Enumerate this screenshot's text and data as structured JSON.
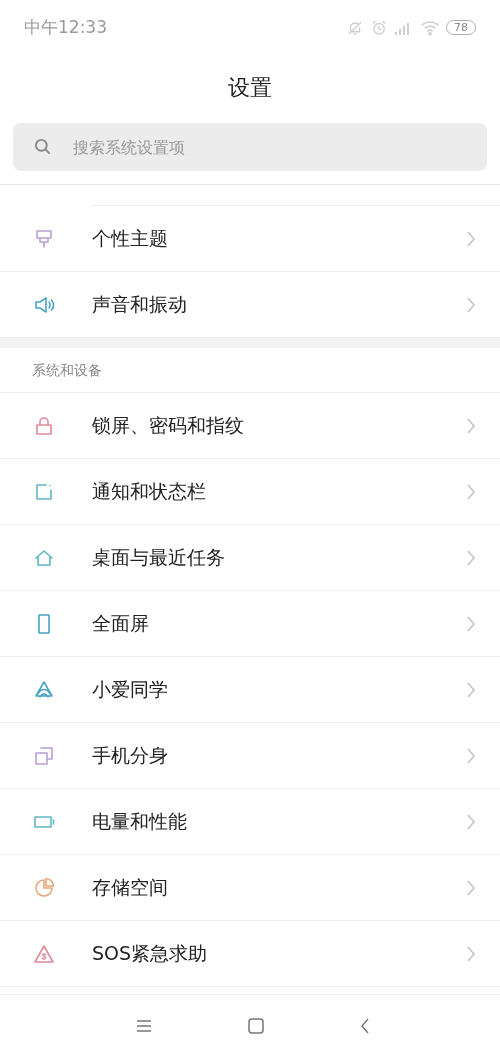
{
  "status_bar": {
    "time": "中午12:33",
    "battery": "78"
  },
  "title": "设置",
  "search": {
    "placeholder": "搜索系统设置项"
  },
  "top_items": [
    {
      "label": "个性主题"
    },
    {
      "label": "声音和振动"
    }
  ],
  "section": {
    "title": "系统和设备",
    "items": [
      {
        "label": "锁屏、密码和指纹"
      },
      {
        "label": "通知和状态栏"
      },
      {
        "label": "桌面与最近任务"
      },
      {
        "label": "全面屏"
      },
      {
        "label": "小爱同学"
      },
      {
        "label": "手机分身"
      },
      {
        "label": "电量和性能"
      },
      {
        "label": "存储空间"
      },
      {
        "label": "SOS紧急求助"
      }
    ]
  }
}
